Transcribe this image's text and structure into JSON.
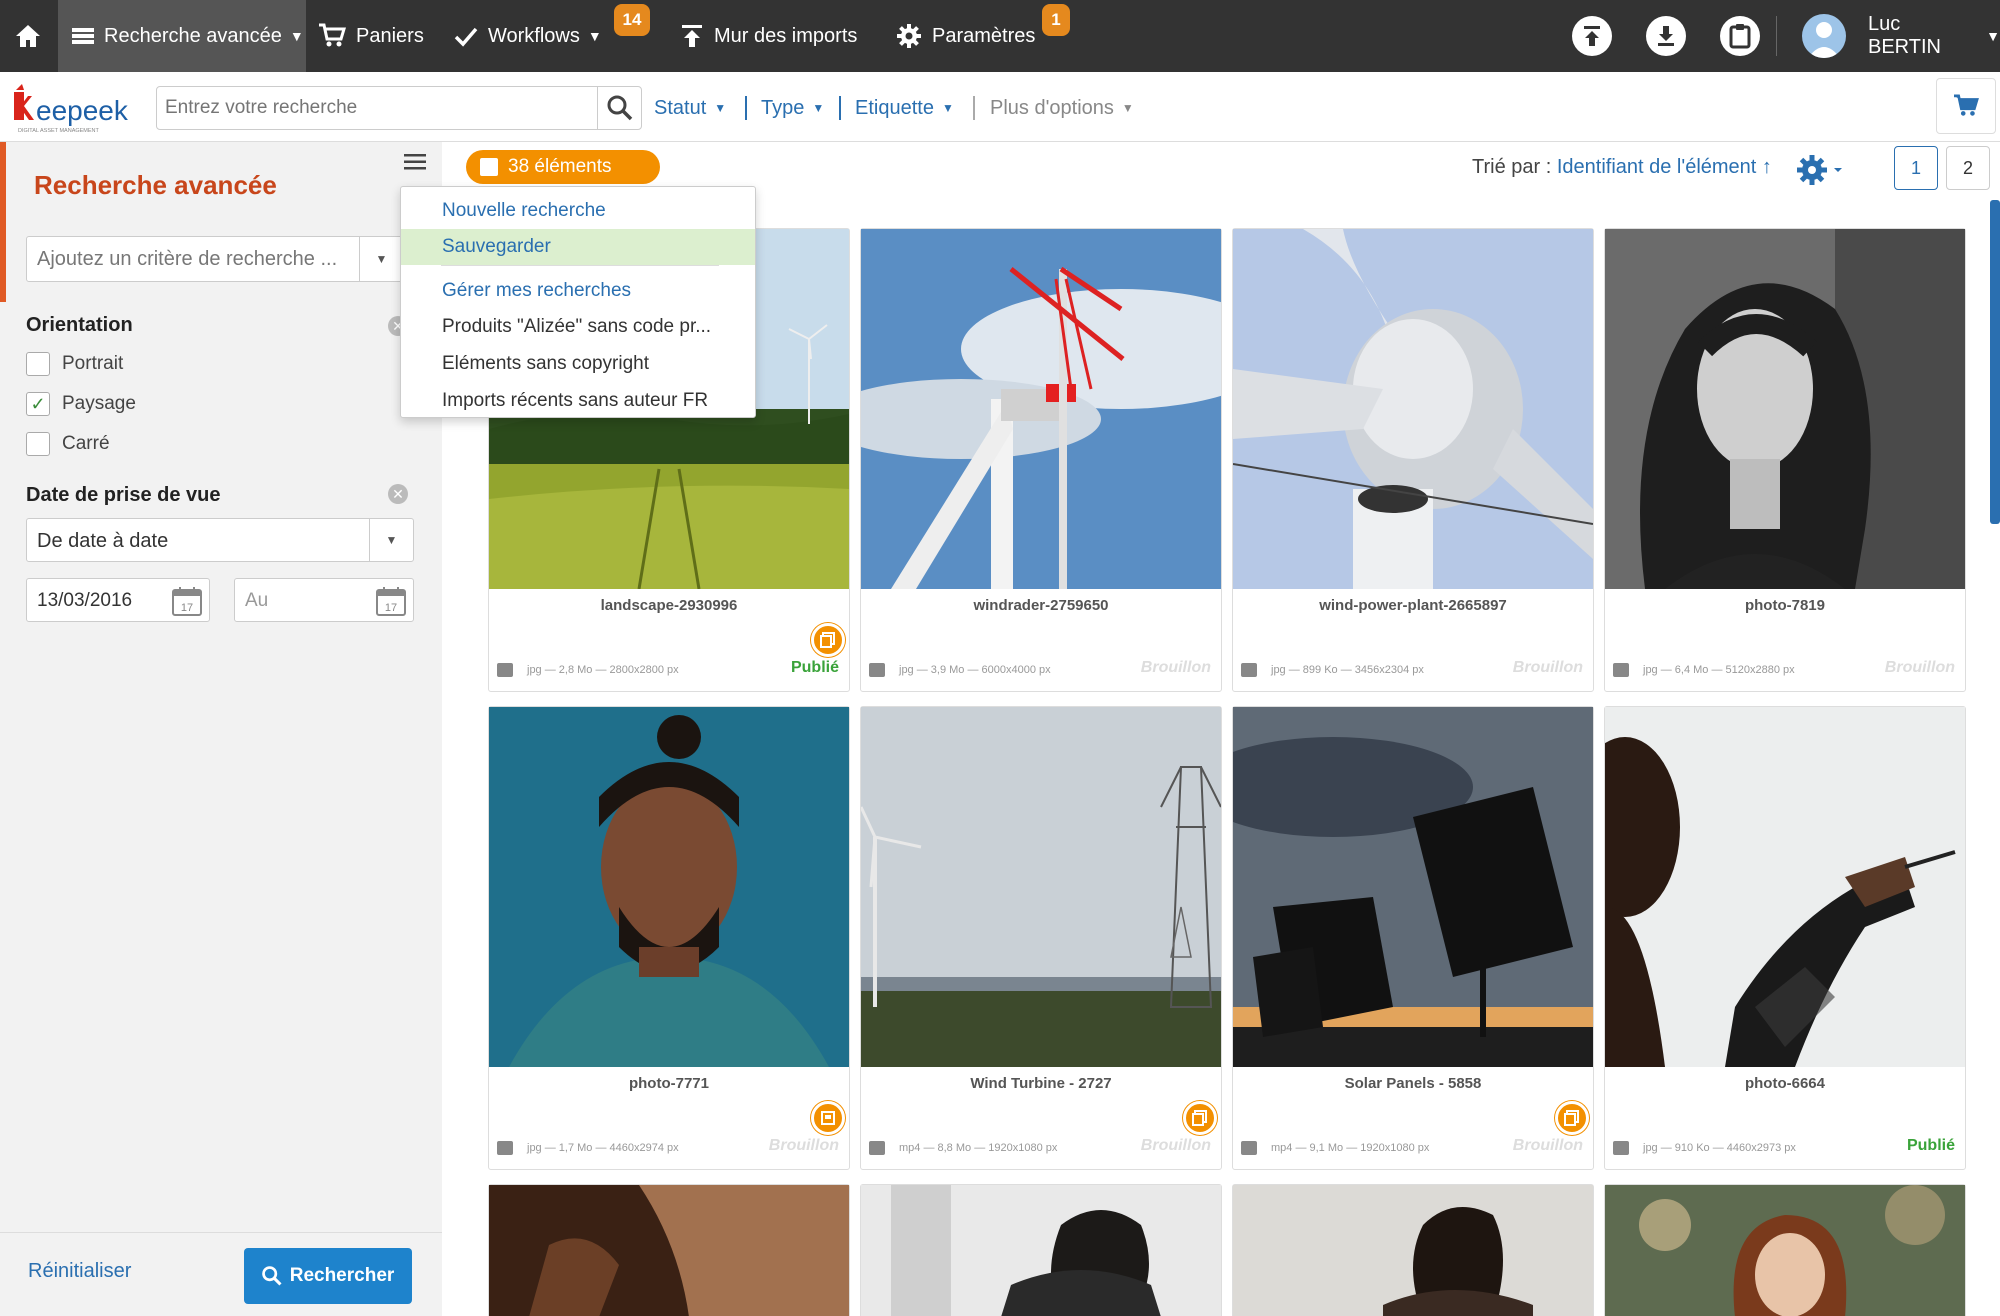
{
  "topnav": {
    "advanced_search": "Recherche avancée",
    "baskets": "Paniers",
    "workflows": "Workflows",
    "workflows_badge": "14",
    "imports_wall": "Mur des imports",
    "settings": "Paramètres",
    "settings_badge": "1",
    "user_name": "Luc BERTIN"
  },
  "header": {
    "logo_text": "Keepeek",
    "logo_tagline": "DIGITAL ASSET MANAGEMENT",
    "search_placeholder": "Entrez votre recherche",
    "filters": [
      "Statut",
      "Type",
      "Etiquette"
    ],
    "more_options": "Plus d'options"
  },
  "sidebar": {
    "title": "Recherche avancée",
    "criteria_placeholder": "Ajoutez un critère de recherche ...",
    "orientation_title": "Orientation",
    "orientation_options": [
      {
        "label": "Portrait",
        "checked": false
      },
      {
        "label": "Paysage",
        "checked": true
      },
      {
        "label": "Carré",
        "checked": false
      }
    ],
    "date_title": "Date de prise de vue",
    "date_mode": "De date à date",
    "date_from": "13/03/2016",
    "date_to_placeholder": "Au",
    "reset": "Réinitialiser",
    "search_button": "Rechercher"
  },
  "results": {
    "count": "38 éléments",
    "sort_label": "Trié par :",
    "sort_value": "Identifiant de l'élément ↑",
    "pages": [
      "1",
      "2"
    ]
  },
  "saved_menu": {
    "items": [
      "Nouvelle recherche",
      "Sauvegarder",
      "Gérer mes recherches",
      "Produits \"Alizée\" sans code pr...",
      "Eléments sans copyright",
      "Imports récents sans auteur FR"
    ]
  },
  "cards": [
    {
      "name": "landscape-2930996",
      "meta": "jpg — 2,8 Mo — 2800x2800 px",
      "status": "Publié"
    },
    {
      "name": "windrader-2759650",
      "meta": "jpg — 3,9 Mo — 6000x4000 px",
      "status": "Brouillon"
    },
    {
      "name": "wind-power-plant-2665897",
      "meta": "jpg — 899 Ko — 3456x2304 px",
      "status": "Brouillon"
    },
    {
      "name": "photo-7819",
      "meta": "jpg — 6,4 Mo — 5120x2880 px",
      "status": "Brouillon"
    },
    {
      "name": "photo-7771",
      "meta": "jpg — 1,7 Mo — 4460x2974 px",
      "status": "Brouillon"
    },
    {
      "name": "Wind Turbine - 2727",
      "meta": "mp4 — 8,8 Mo — 1920x1080 px",
      "status": "Brouillon"
    },
    {
      "name": "Solar Panels - 5858",
      "meta": "mp4 — 9,1 Mo — 1920x1080 px",
      "status": "Brouillon"
    },
    {
      "name": "photo-6664",
      "meta": "jpg — 910 Ko — 4460x2973 px",
      "status": "Publié"
    }
  ],
  "colors": {
    "accent": "#f39000",
    "brand": "#c8461b",
    "link": "#2a6fb0",
    "topbar": "#333333"
  }
}
